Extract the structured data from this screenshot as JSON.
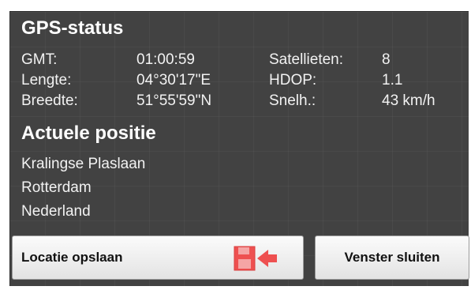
{
  "gps_status": {
    "title": "GPS-status",
    "rows": [
      {
        "label": "GMT:",
        "value": "01:00:59",
        "label2": "Satellieten:",
        "value2": "8"
      },
      {
        "label": "Lengte:",
        "value": "04°30'17\"E",
        "label2": "HDOP:",
        "value2": "1.1"
      },
      {
        "label": "Breedte:",
        "value": "51°55'59\"N",
        "label2": "Snelh.:",
        "value2": "43 km/h"
      }
    ]
  },
  "position": {
    "title": "Actuele positie",
    "lines": [
      "Kralingse Plaslaan",
      "Rotterdam",
      "Nederland"
    ]
  },
  "buttons": {
    "save_label": "Locatie opslaan",
    "close_label": "Venster sluiten"
  },
  "icons": {
    "save": "save-location-icon",
    "save_color": "#ee5050"
  }
}
